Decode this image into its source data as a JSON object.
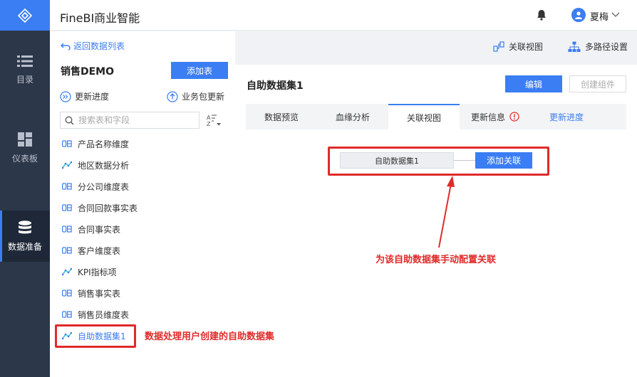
{
  "app": {
    "title": "FineBI商业智能"
  },
  "user": {
    "name": "夏梅"
  },
  "nav": {
    "items": [
      {
        "label": "目录",
        "icon": "list-icon"
      },
      {
        "label": "仪表板",
        "icon": "dashboard-icon"
      },
      {
        "label": "数据准备",
        "icon": "database-icon",
        "active": true
      }
    ]
  },
  "panel": {
    "back_label": "返回数据列表",
    "package_title": "销售DEMO",
    "add_table_label": "添加表",
    "update_progress_label": "更新进度",
    "package_update_label": "业务包更新",
    "search_placeholder": "搜索表和字段",
    "tables": [
      {
        "name": "产品名称维度",
        "icon": "db-table-icon"
      },
      {
        "name": "地区数据分析",
        "icon": "self-service-dataset-icon"
      },
      {
        "name": "分公司维度表",
        "icon": "db-table-icon"
      },
      {
        "name": "合同回款事实表",
        "icon": "db-table-icon"
      },
      {
        "name": "合同事实表",
        "icon": "db-table-icon"
      },
      {
        "name": "客户维度表",
        "icon": "db-table-icon"
      },
      {
        "name": "KPI指标项",
        "icon": "self-service-dataset-icon"
      },
      {
        "name": "销售事实表",
        "icon": "db-table-icon"
      },
      {
        "name": "销售员维度表",
        "icon": "db-table-icon"
      },
      {
        "name": "自助数据集1",
        "icon": "self-service-dataset-icon",
        "selected": true
      }
    ]
  },
  "toolbar": {
    "relation_view_label": "关联视图",
    "multipath_label": "多路径设置"
  },
  "main": {
    "dataset_title": "自助数据集1",
    "edit_label": "编辑",
    "create_component_label": "创建组件",
    "tabs": [
      {
        "label": "数据预览"
      },
      {
        "label": "血缘分析"
      },
      {
        "label": "关联视图",
        "active": true
      },
      {
        "label": "更新信息"
      },
      {
        "label": "更新进度"
      }
    ],
    "node_label": "自助数据集1",
    "add_relation_label": "添加关联"
  },
  "annotations": {
    "dataset_note": "数据处理用户创建的自助数据集",
    "relation_note": "为该自助数据集手动配置关联"
  },
  "colors": {
    "accent": "#3b7df3",
    "nav_bg": "#2c3749",
    "annotation": "#e02a2a",
    "warning": "#e02a2a"
  }
}
